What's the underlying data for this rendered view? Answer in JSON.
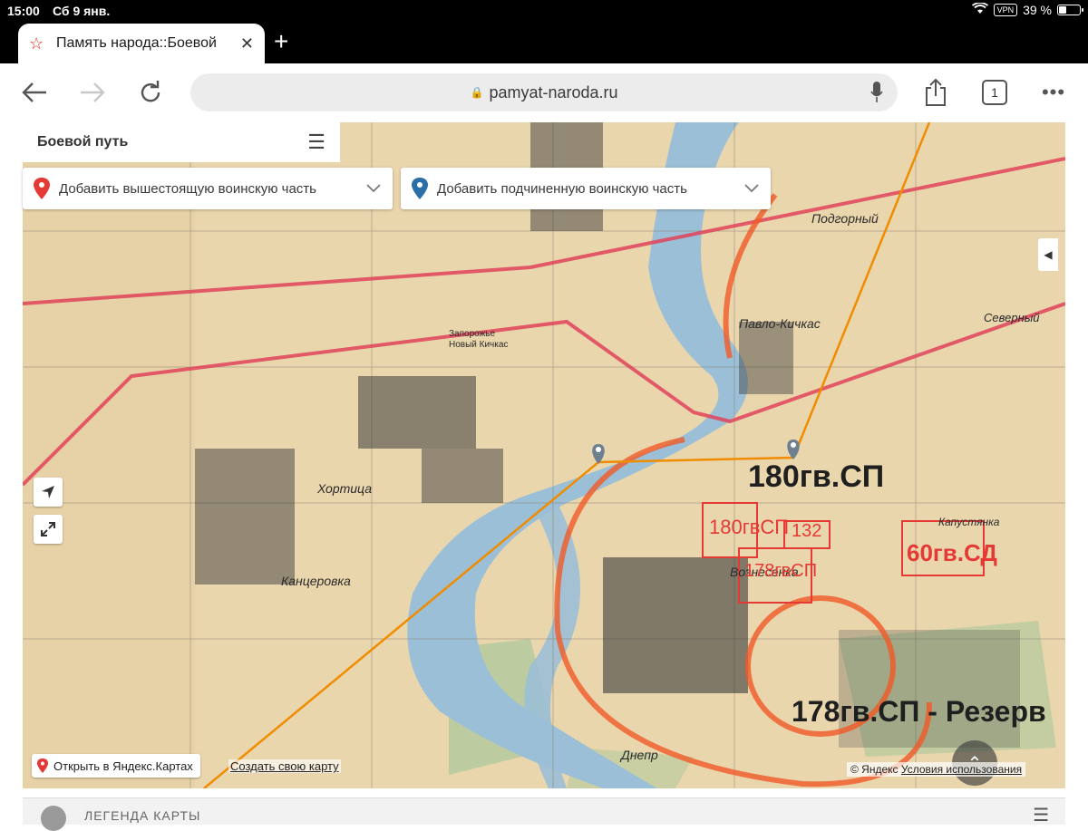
{
  "status_bar": {
    "time": "15:00",
    "date": "Сб 9 янв.",
    "vpn": "VPN",
    "battery": "39 %",
    "battery_level_percent": 39
  },
  "browser": {
    "tab_title": "Память народа::Боевой",
    "url": "pamyat-naroda.ru",
    "tab_count": "1"
  },
  "panel": {
    "title": "Боевой путь"
  },
  "selectors": {
    "parent_unit": "Добавить вышестоящую воинскую часть",
    "child_unit": "Добавить подчиненную воинскую часть"
  },
  "map": {
    "open_in_yandex": "Открыть в Яндекс.Картах",
    "create_map": "Создать свою карту",
    "attribution_prefix": "© Яндекс",
    "attribution_terms": "Условия использования",
    "route_color": "#f08c00",
    "marker_color": "#6e7f8f",
    "place_labels": [
      "Подгорный",
      "Павло-Кичкас",
      "Северный",
      "Запорожье",
      "Новый Кичкас",
      "Хортица",
      "Канцеровка",
      "Вознесенка",
      "Днепр",
      "Капустянка"
    ],
    "unit_annotations": [
      "180гв.СП",
      "180гвСП",
      "132",
      "178гвСП",
      "60гв.СД",
      "178гв.СП - Резерв"
    ]
  },
  "legend": {
    "label": "ЛЕГЕНДА КАРТЫ"
  },
  "colors": {
    "pin_parent": "#e53935",
    "pin_child": "#2a6fa8",
    "river": "#9bbfd6",
    "map_paper": "#ecd8b0"
  }
}
